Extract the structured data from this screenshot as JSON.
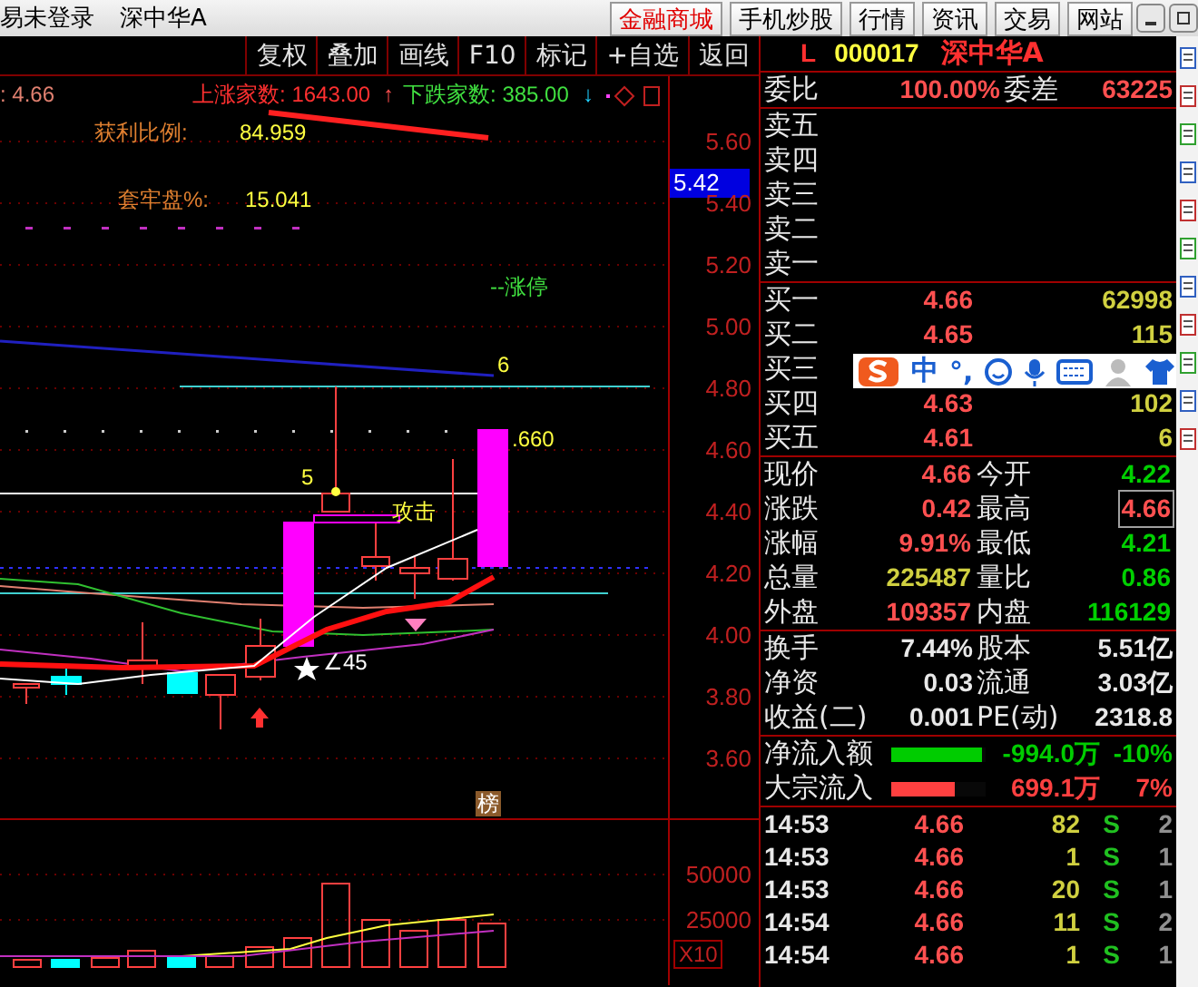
{
  "titlebar": {
    "status": "易未登录",
    "stock": "深中华A",
    "buttons": [
      {
        "label": "金融商城",
        "selected": true
      },
      {
        "label": "手机炒股",
        "selected": false
      },
      {
        "label": "行情",
        "selected": false
      },
      {
        "label": "资讯",
        "selected": false
      },
      {
        "label": "交易",
        "selected": false
      },
      {
        "label": "网站",
        "selected": false
      }
    ]
  },
  "toolbar": [
    "复权",
    "叠加",
    "画线",
    "F10",
    "标记",
    "+自选",
    "返回"
  ],
  "chart": {
    "price": ": 4.66",
    "up_count": {
      "label": "上涨家数:",
      "value": "1643.00",
      "arrow": "↑"
    },
    "down_count": {
      "label": "下跌家数:",
      "value": "385.00",
      "arrow": "↓"
    },
    "profit_ratio": {
      "label": "获利比例:",
      "value": "84.959"
    },
    "trapped_ratio": {
      "label": "套牢盘%:",
      "value": "15.041"
    },
    "limit_up": "--涨停",
    "annotations": [
      {
        "kind": "level",
        "text": "6"
      },
      {
        "kind": "price",
        "text": ".660"
      },
      {
        "kind": "level",
        "text": "5"
      },
      {
        "kind": "signal",
        "text": "攻击"
      },
      {
        "kind": "angle",
        "text": "∠45"
      }
    ],
    "badge": "榜",
    "price_tag": "5.42",
    "price_axis": [
      "5.60",
      "5.40",
      "5.20",
      "5.00",
      "4.80",
      "4.60",
      "4.40",
      "4.20",
      "4.00",
      "3.80",
      "3.60"
    ]
  },
  "volume": {
    "axis": [
      "50000",
      "25000"
    ],
    "scale": "X10"
  },
  "quote": {
    "flag": "L",
    "code": "000017",
    "name": "深中华A",
    "ratio": {
      "label": "委比",
      "value": "100.00%",
      "diff_label": "委差",
      "diff": "63225"
    },
    "asks": [
      {
        "label": "卖五"
      },
      {
        "label": "卖四"
      },
      {
        "label": "卖三"
      },
      {
        "label": "卖二"
      },
      {
        "label": "卖一"
      }
    ],
    "bids": [
      {
        "label": "买一",
        "price": "4.66",
        "volume": "62998"
      },
      {
        "label": "买二",
        "price": "4.65",
        "volume": "115"
      },
      {
        "label": "买三"
      },
      {
        "label": "买四",
        "price": "4.63",
        "volume": "102"
      },
      {
        "label": "买五",
        "price": "4.61",
        "volume": "6"
      }
    ],
    "stats": [
      {
        "label": "现价",
        "value": "4.66",
        "color": "#ff5050",
        "highlighted": false
      },
      {
        "label": "今开",
        "value": "4.22",
        "color": "#00d000",
        "highlighted": false
      },
      {
        "label": "涨跌",
        "value": "0.42",
        "color": "#ff5050",
        "highlighted": false
      },
      {
        "label": "最高",
        "value": "4.66",
        "color": "#ff5050",
        "highlighted": true
      },
      {
        "label": "涨幅",
        "value": "9.91%",
        "color": "#ff5050",
        "highlighted": false
      },
      {
        "label": "最低",
        "value": "4.21",
        "color": "#00d000",
        "highlighted": false
      },
      {
        "label": "总量",
        "value": "225487",
        "color": "#d0d040",
        "highlighted": false
      },
      {
        "label": "量比",
        "value": "0.86",
        "color": "#00d000",
        "highlighted": false
      },
      {
        "label": "外盘",
        "value": "109357",
        "color": "#ff5050",
        "highlighted": false
      },
      {
        "label": "内盘",
        "value": "116129",
        "color": "#00d000",
        "highlighted": false
      }
    ],
    "fundamentals": [
      {
        "label": "换手",
        "value": "7.44%"
      },
      {
        "label": "股本",
        "value": "5.51亿"
      },
      {
        "label": "净资",
        "value": "0.03"
      },
      {
        "label": "流通",
        "value": "3.03亿"
      },
      {
        "label": "收益(二)",
        "value": "0.001"
      },
      {
        "label": "PE(动)",
        "value": "2318.8"
      }
    ],
    "flows": [
      {
        "label": "净流入额",
        "amount": "-994.0万",
        "pct": "-10%",
        "level": 0.96,
        "color": "#00cc00"
      },
      {
        "label": "大宗流入",
        "amount": "699.1万",
        "pct": "7%",
        "level": 0.67,
        "color": "#ff4040"
      }
    ],
    "trades": [
      {
        "time": "14:53",
        "price": "4.66",
        "volume": "82",
        "side": "S",
        "count": "2"
      },
      {
        "time": "14:53",
        "price": "4.66",
        "volume": "1",
        "side": "S",
        "count": "1"
      },
      {
        "time": "14:53",
        "price": "4.66",
        "volume": "20",
        "side": "S",
        "count": "1"
      },
      {
        "time": "14:54",
        "price": "4.66",
        "volume": "11",
        "side": "S",
        "count": "2"
      },
      {
        "time": "14:54",
        "price": "4.66",
        "volume": "1",
        "side": "S",
        "count": "1"
      }
    ]
  },
  "ime": {
    "mode": "中",
    "punct": "°,"
  }
}
